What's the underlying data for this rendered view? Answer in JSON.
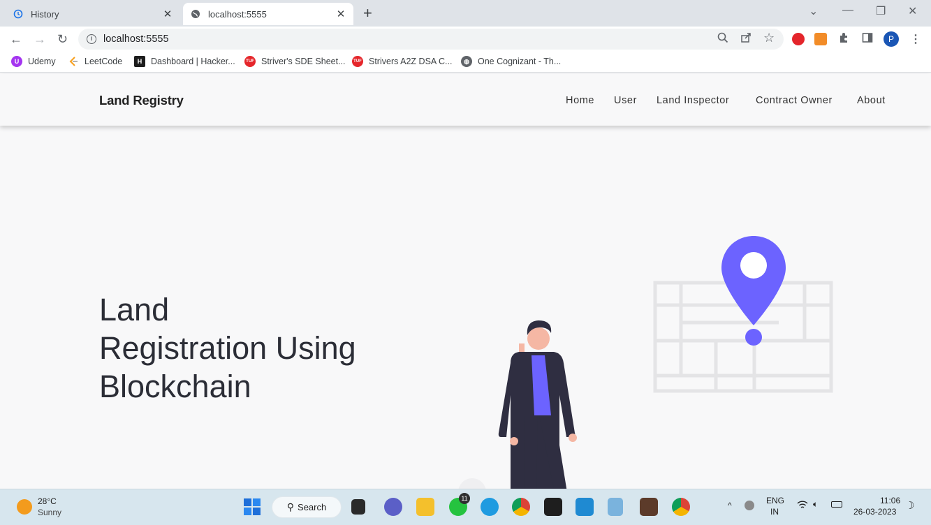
{
  "browser": {
    "tabs": [
      {
        "title": "History",
        "active": false,
        "icon": "history-icon"
      },
      {
        "title": "localhost:5555",
        "active": true,
        "icon": "globe-icon"
      }
    ],
    "url": "localhost:5555",
    "profile_initial": "P"
  },
  "bookmarks": [
    {
      "label": "Udemy",
      "icon": "udemy-icon",
      "color": "#a435f0"
    },
    {
      "label": "LeetCode",
      "icon": "leetcode-icon",
      "color": "#f89f1b"
    },
    {
      "label": "Dashboard | Hacker...",
      "icon": "hackerrank-icon",
      "color": "#1d1d1d"
    },
    {
      "label": "Striver's SDE Sheet...",
      "icon": "tuf-icon",
      "color": "#e5262b"
    },
    {
      "label": "Strivers A2Z DSA C...",
      "icon": "tuf-icon",
      "color": "#e5262b"
    },
    {
      "label": "One Cognizant - Th...",
      "icon": "globe-icon",
      "color": "#5f6368"
    }
  ],
  "navbar": {
    "brand": "Land Registry",
    "links": [
      "Home",
      "User",
      "Land Inspector",
      "Contract Owner",
      "About"
    ]
  },
  "hero": {
    "line1": "Land",
    "line2": "Registration Using",
    "line3": "Blockchain",
    "accent_color": "#6c63ff"
  },
  "taskbar": {
    "temperature": "28°C",
    "weather": "Sunny",
    "search_label": "Search",
    "whatsapp_badge": "11",
    "language": "ENG",
    "region": "IN",
    "time": "11:06",
    "date": "26-03-2023"
  }
}
